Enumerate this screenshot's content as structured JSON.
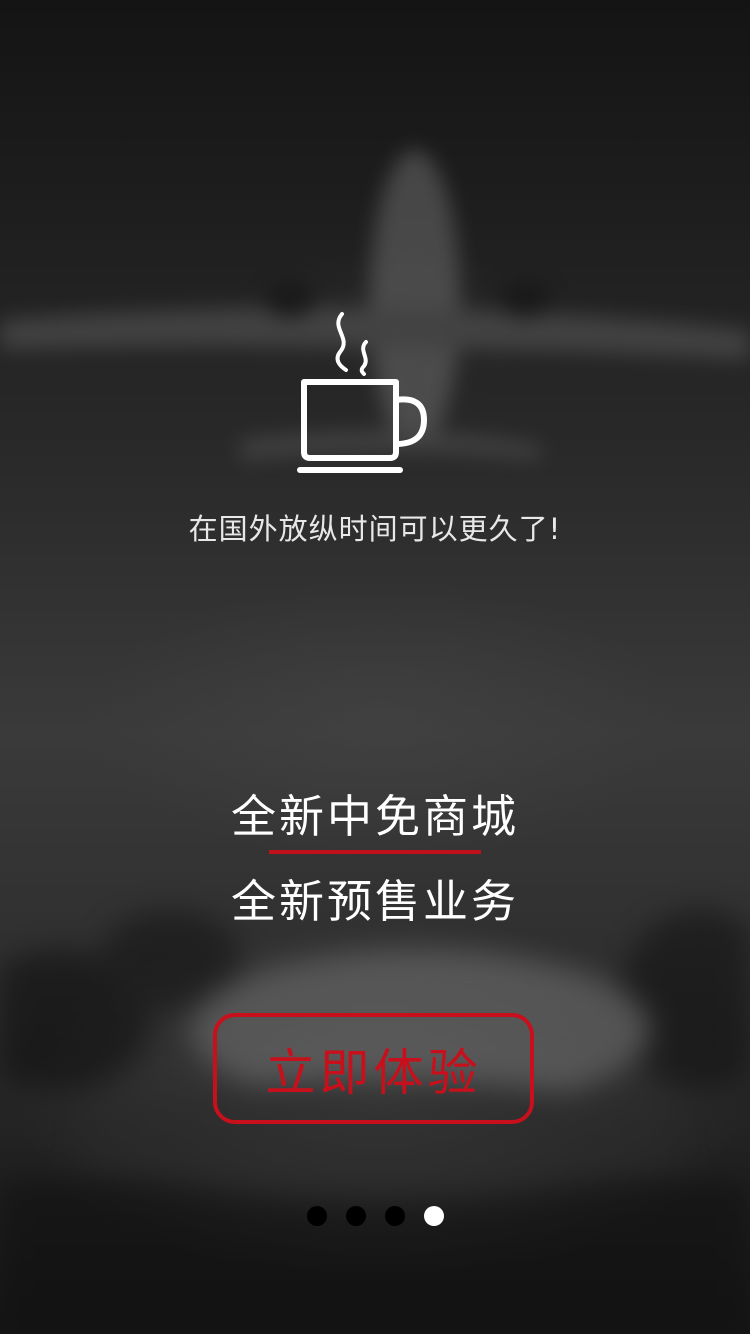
{
  "onboarding": {
    "tagline": "在国外放纵时间可以更久了!",
    "headline_line1": "全新中免商城",
    "headline_line2": "全新预售业务",
    "cta_label": "立即体验",
    "icon": "coffee-cup-icon"
  },
  "pagination": {
    "total": 4,
    "current": 4
  },
  "colors": {
    "accent": "#c8101c",
    "text": "#ffffff",
    "background": "#1a1a1a"
  }
}
